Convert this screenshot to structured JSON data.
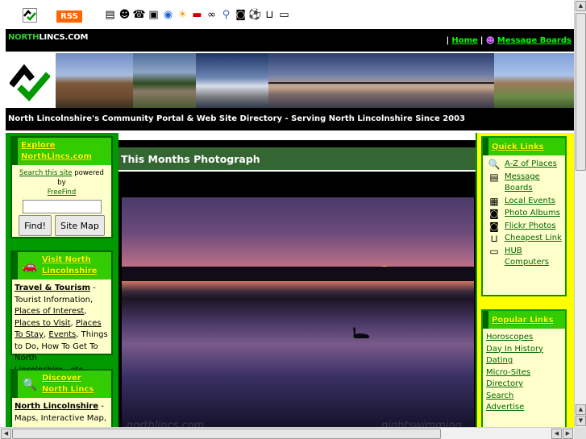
{
  "toolbar": {
    "rss_label": "RSS",
    "icons": [
      "board-icon",
      "people-icon",
      "phone-icon",
      "album-icon",
      "globe-icon",
      "sun-icon",
      "car-icon",
      "links-icon",
      "search-icon",
      "camera-icon",
      "football-icon",
      "cart-icon",
      "computer-icon"
    ]
  },
  "header": {
    "brand_north": "NORTH",
    "brand_rest": "LINCS.COM",
    "sep": "|",
    "home_link": "Home",
    "sep2": "|",
    "boards_link": "Message Boards"
  },
  "tagline": "North Lincolnshire's Community Portal & Web Site Directory - Serving North Lincolnshire Since 2003",
  "left": {
    "explore": {
      "title": "Explore NorthLincs.com",
      "search_link": "Search this site",
      "powered_by": "powered by",
      "freefind": "FreeFind",
      "search_value": "",
      "find_button": "Find!",
      "sitemap_button": "Site Map"
    },
    "visit": {
      "title": "Visit North Lincolnshire",
      "travel": "Travel & Tourism",
      "dash1": " - Tourist Information, ",
      "places_interest": "Places of Interest",
      "c1": ", ",
      "places_visit": "Places to Visit",
      "c2": ", ",
      "places_stay": "Places To Stay",
      "c3": ", ",
      "events": "Events",
      "rest": ", Things to Do, How To Get To North Lincolnshire...etc."
    },
    "discover": {
      "title": "Discover North Lincs",
      "nl_link": "North Lincolnshire",
      "rest": " - Maps, Interactive Map,"
    }
  },
  "center": {
    "title": "This Months Photograph",
    "watermark_left": "northlincs.com",
    "watermark_right": "nightswimming"
  },
  "right": {
    "quick": {
      "title": "Quick Links",
      "items": [
        {
          "label": "A-Z of Places",
          "icon": "magnifier-icon"
        },
        {
          "label": "Message Boards",
          "icon": "board-icon"
        },
        {
          "label": "Local Events",
          "icon": "calendar-icon"
        },
        {
          "label": "Photo Albums",
          "icon": "camera-icon"
        },
        {
          "label": "Flickr Photos",
          "icon": "camera-icon"
        },
        {
          "label": "Cheapest Link",
          "icon": "cart-icon"
        },
        {
          "label": "HUB Computers",
          "icon": "computer-icon"
        }
      ]
    },
    "popular": {
      "title": "Popular Links",
      "items": [
        "Horoscopes",
        "Day In History",
        "Dating",
        "Micro-Sites",
        "Directory",
        "Search",
        "Advertise"
      ]
    }
  },
  "colors": {
    "green_dark": "#006600",
    "green": "#009900",
    "green_bright": "#33cc00",
    "yellow": "#ffff00",
    "cream": "#ffffcc",
    "rss": "#ff6600"
  }
}
